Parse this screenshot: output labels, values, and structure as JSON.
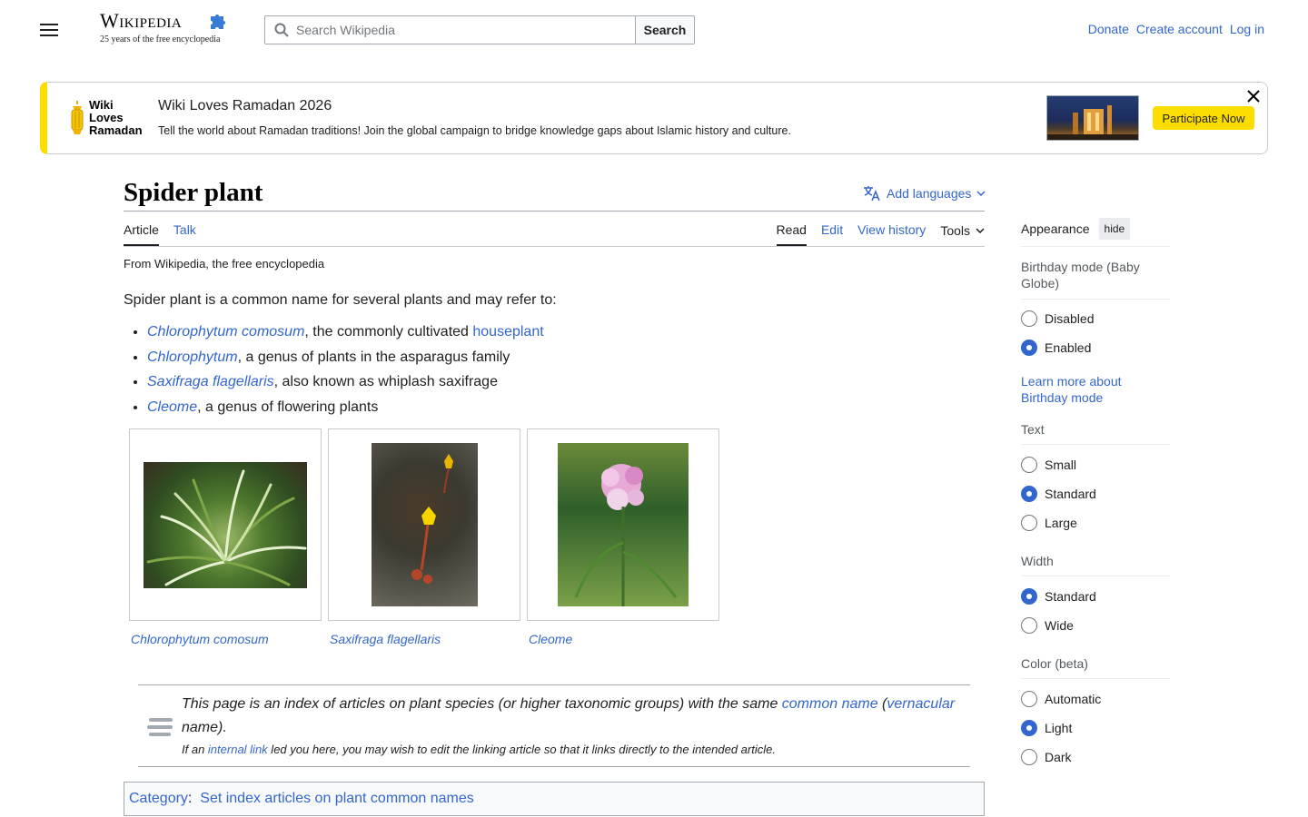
{
  "header": {
    "logo_word": "Wikipedia",
    "logo_tagline": "25 years of the free encyclopedia",
    "search_placeholder": "Search Wikipedia",
    "search_button": "Search",
    "user_links": [
      "Donate",
      "Create account",
      "Log in"
    ]
  },
  "banner": {
    "logo_lines": [
      "Wiki",
      "Loves",
      "Ramadan"
    ],
    "title": "Wiki Loves Ramadan 2026",
    "text": "Tell the world about Ramadan traditions! Join the global campaign to bridge knowledge gaps about Islamic history and culture.",
    "cta": "Participate Now"
  },
  "page": {
    "title": "Spider plant",
    "add_languages": "Add languages",
    "tabs_left": [
      "Article",
      "Talk"
    ],
    "tabs_right": [
      "Read",
      "Edit",
      "View history",
      "Tools"
    ],
    "tagline": "From Wikipedia, the free encyclopedia",
    "intro": "Spider plant is a common name for several plants and may refer to:",
    "bullets": [
      {
        "link": "Chlorophytum comosum",
        "text": ", the commonly cultivated ",
        "link2": "houseplant"
      },
      {
        "link": "Chlorophytum",
        "text": ", a genus of plants in the asparagus family"
      },
      {
        "link": "Saxifraga flagellaris",
        "text": ", also known as whiplash saxifrage"
      },
      {
        "link": "Cleome",
        "text": ", a genus of flowering plants"
      }
    ],
    "gallery": [
      {
        "caption": "Chlorophytum comosum"
      },
      {
        "caption": "Saxifraga flagellaris"
      },
      {
        "caption": "Cleome"
      }
    ],
    "hatnote": {
      "main_1": "This page is an index of articles on plant species (or higher taxonomic groups) with the same ",
      "link_1": "common name",
      "main_2": " (",
      "link_2": "vernacular",
      "main_3": " name).",
      "sub_1": "If an ",
      "sub_link": "internal link",
      "sub_2": " led you here, you may wish to edit the linking article so that it links directly to the intended article."
    },
    "category": {
      "label": "Category",
      "sep": ":",
      "link": "Set index articles on plant common names"
    }
  },
  "sidebar": {
    "title": "Appearance",
    "hide": "hide",
    "birthday": {
      "label": "Birthday mode (Baby Globe)",
      "options": [
        "Disabled",
        "Enabled"
      ],
      "selected": "Enabled",
      "learn_more": "Learn more about Birthday mode"
    },
    "text": {
      "label": "Text",
      "options": [
        "Small",
        "Standard",
        "Large"
      ],
      "selected": "Standard"
    },
    "width": {
      "label": "Width",
      "options": [
        "Standard",
        "Wide"
      ],
      "selected": "Standard"
    },
    "color": {
      "label": "Color (beta)",
      "options": [
        "Automatic",
        "Light",
        "Dark"
      ],
      "selected": "Light"
    }
  },
  "colors": {
    "link": "#3366cc",
    "accent_yellow": "#fddd00",
    "text": "#202122"
  }
}
